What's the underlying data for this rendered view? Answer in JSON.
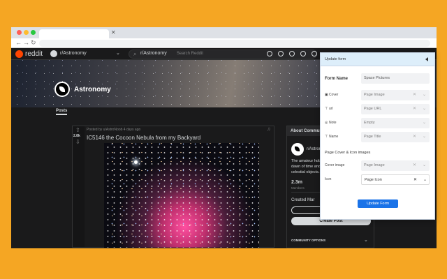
{
  "reddit": {
    "logo": "reddit",
    "community_selector": "r/Astronomy",
    "search_chip": "r/Astronomy",
    "search_placeholder": "Search Reddit",
    "banner_title": "Astronomy",
    "posts_tab": "Posts"
  },
  "post": {
    "vote_count": "2.8k",
    "meta": "Posted by u/AstroNoob 4 days ago",
    "title": "IC5146 the Cocoon Nebula from my Backyard"
  },
  "sidebar": {
    "header": "About Community",
    "name": "r/Astronomy",
    "description": "The amateur hobby of astronomy from the dawn of time and the exploration of all celestial objects...",
    "members_count": "2.3m",
    "members_label": "Members",
    "created": "Created Mar",
    "create_post": "Create Post",
    "community_options": "COMMUNITY OPTIONS"
  },
  "popup": {
    "title": "Update form",
    "form_name_label": "Form Name",
    "form_name_value": "Space Pictures",
    "rows": [
      {
        "icon": "▣",
        "label": "Cover",
        "value": "Page Image"
      },
      {
        "icon": "⊤",
        "label": "url",
        "value": "Page URL"
      },
      {
        "icon": "◎",
        "label": "Note",
        "value": "Empty"
      },
      {
        "icon": "⊤",
        "label": "Name",
        "value": "Page Title"
      }
    ],
    "section_title": "Page Cover & Icon images",
    "images": [
      {
        "label": "Cover image",
        "value": "Page Image"
      },
      {
        "label": "Icon",
        "value": "Page Icon"
      }
    ],
    "update_button": "Update Form"
  }
}
